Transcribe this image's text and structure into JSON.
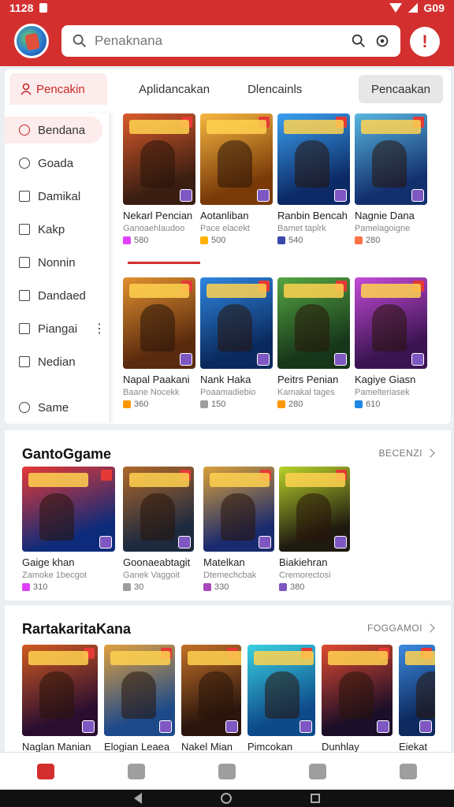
{
  "status": {
    "time": "1128",
    "battery": "G09"
  },
  "search": {
    "placeholder": "Penaknana"
  },
  "tabs": [
    {
      "label": "Pencakin"
    },
    {
      "label": "Aplidancakan"
    },
    {
      "label": "Dlencainls"
    },
    {
      "label": "Pencaakan"
    }
  ],
  "side_menu": [
    {
      "label": "Bendana",
      "icon": "search-icon"
    },
    {
      "label": "Goada",
      "icon": "person-icon"
    },
    {
      "label": "Damikal",
      "icon": "mail-icon"
    },
    {
      "label": "Kakp",
      "icon": "hand-icon"
    },
    {
      "label": "Nonnin",
      "icon": "square-icon"
    },
    {
      "label": "Dandaed",
      "icon": "doc-icon"
    },
    {
      "label": "Piangai",
      "icon": "square-icon"
    },
    {
      "label": "Nedian",
      "icon": "square-icon"
    },
    {
      "label": "Same",
      "icon": "person-icon"
    }
  ],
  "top_games": [
    {
      "title": "Nekarl Pencian",
      "sub": "Ganoaehlaudoo",
      "meta": "580",
      "c1": "#3a1e12",
      "c2": "#d95a2b",
      "dot": "#e040fb"
    },
    {
      "title": "Aotanliban",
      "sub": "Pace elacekt",
      "meta": "500",
      "c1": "#7a3a08",
      "c2": "#f6b640",
      "dot": "#ffb300"
    },
    {
      "title": "Ranbin Bencah",
      "sub": "Bamet taplrk",
      "meta": "540",
      "c1": "#0c2a66",
      "c2": "#3aa0f0",
      "dot": "#3949ab"
    },
    {
      "title": "Nagnie Dana",
      "sub": "Pamelagoigne",
      "meta": "280",
      "c1": "#13306e",
      "c2": "#58b6e0",
      "dot": "#ff7043"
    },
    {
      "title": "Napal Paakani",
      "sub": "Baane Nocekk",
      "meta": "360",
      "c1": "#5a2a0e",
      "c2": "#e0902f",
      "dot": "#ff9800"
    },
    {
      "title": "Nank Haka",
      "sub": "Poaamadiebio",
      "meta": "150",
      "c1": "#0a2a5e",
      "c2": "#2f86e0",
      "dot": "#9e9e9e"
    },
    {
      "title": "Peitrs Penian",
      "sub": "Kamakal tages",
      "meta": "280",
      "c1": "#17361a",
      "c2": "#55a642",
      "dot": "#ff9800"
    },
    {
      "title": "Kagiye Giasn",
      "sub": "Pamelteriasek",
      "meta": "610",
      "c1": "#3a1450",
      "c2": "#c44ad8",
      "dot": "#1e88e5"
    }
  ],
  "section1": {
    "title": "GantoGgame",
    "see_all": "BECENZI",
    "games": [
      {
        "title": "Gaige khan",
        "sub": "Zamoke 1becgot",
        "meta": "310",
        "c1": "#0d2b7a",
        "c2": "#e53935",
        "dot": "#e040fb"
      },
      {
        "title": "Goonaeabtagit",
        "sub": "Ganek Vaggoit",
        "meta": "30",
        "c1": "#1c2a40",
        "c2": "#b0682a",
        "dot": "#9e9e9e"
      },
      {
        "title": "Matelkan",
        "sub": "Dtemechcbak",
        "meta": "330",
        "c1": "#1a2a6e",
        "c2": "#d9a03a",
        "dot": "#ab47bc"
      },
      {
        "title": "Biakiehran",
        "sub": "Cremorectosi",
        "meta": "380",
        "c1": "#1f1a10",
        "c2": "#b8d22a",
        "dot": "#7e57c2"
      }
    ]
  },
  "section2": {
    "title": "RartakaritaKana",
    "see_all": "FOGGAMOI",
    "games": [
      {
        "title": "Naglan Manian",
        "c1": "#2a0e30",
        "c2": "#d05a20"
      },
      {
        "title": "Elogian Leaea",
        "c1": "#1c4a8a",
        "c2": "#e0a040"
      },
      {
        "title": "Nakel Mian",
        "c1": "#2a160e",
        "c2": "#c47028"
      },
      {
        "title": "Pimcokan",
        "c1": "#0d4a8a",
        "c2": "#3ad0e0"
      },
      {
        "title": "Dunhlay",
        "c1": "#1a0e28",
        "c2": "#e04a30"
      },
      {
        "title": "Eiekat",
        "c1": "#0e2a5e",
        "c2": "#3a8ae0"
      }
    ]
  },
  "colors": {
    "accent": "#d32f2f",
    "accent_soft": "#fdecec"
  },
  "bottom_nav": [
    "home-icon",
    "folder-icon",
    "square-icon",
    "lock-icon",
    "wrench-icon"
  ]
}
